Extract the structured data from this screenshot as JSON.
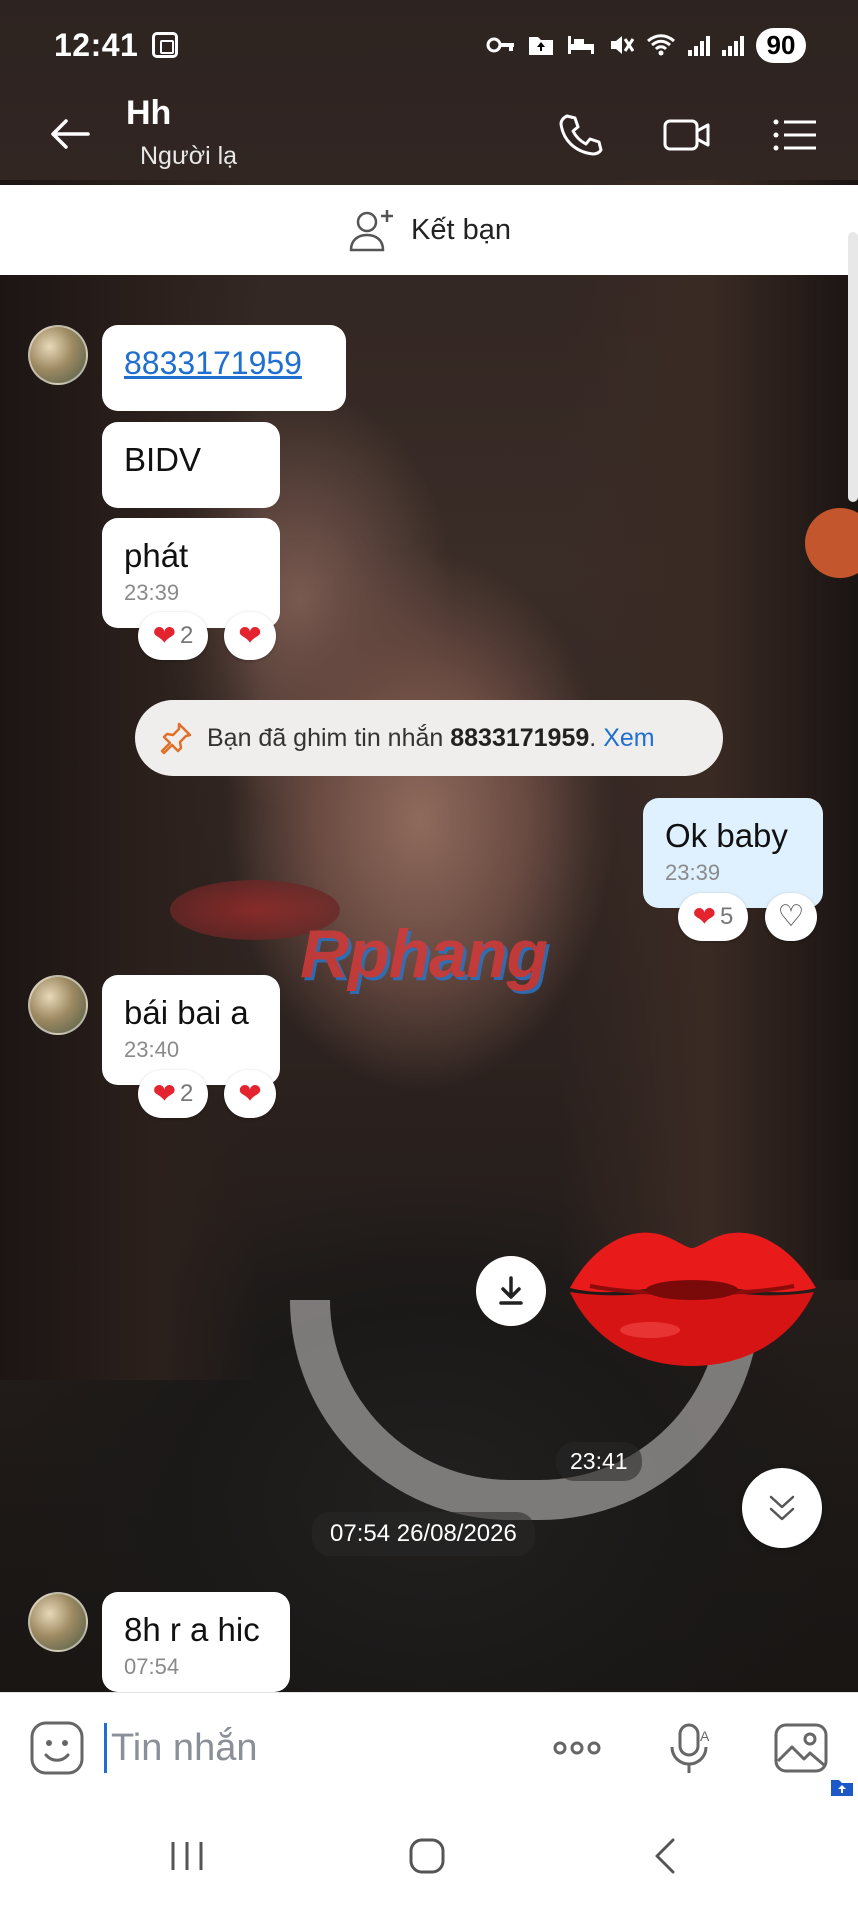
{
  "status_bar": {
    "time": "12:41",
    "battery": "90"
  },
  "header": {
    "contact_name": "Hh",
    "contact_status": "Người lạ"
  },
  "friend_bar": {
    "label": "Kết bạn"
  },
  "messages": [
    {
      "from": "them",
      "text": "8833171959",
      "is_link": true
    },
    {
      "from": "them",
      "text": "BIDV"
    },
    {
      "from": "them",
      "text": "phát",
      "time": "23:39",
      "reactions": [
        {
          "emoji": "heart",
          "count": "2"
        },
        {
          "emoji": "heart",
          "count": ""
        }
      ]
    },
    {
      "from": "me",
      "text": "Ok baby",
      "time": "23:39",
      "reactions": [
        {
          "emoji": "heart",
          "count": "5"
        },
        {
          "emoji": "heart-outline",
          "count": ""
        }
      ]
    },
    {
      "from": "them",
      "text": "bái bai a",
      "time": "23:40",
      "reactions": [
        {
          "emoji": "heart",
          "count": "2"
        },
        {
          "emoji": "heart",
          "count": ""
        }
      ]
    },
    {
      "from": "them",
      "type": "sticker",
      "sticker": "red-lips",
      "time": "23:41"
    },
    {
      "from": "them",
      "text": "8h r a hic",
      "time": "07:54"
    }
  ],
  "pin_notice": {
    "prefix": "Bạn đã ghim tin nhắn ",
    "value": "8833171959",
    "suffix": ".",
    "action": "Xem"
  },
  "date_separator": "07:54 26/08/2026",
  "watermark": "Rphang",
  "composer": {
    "placeholder": "Tin nhắn"
  },
  "colors": {
    "link": "#1f6fd0",
    "heart": "#e3232e",
    "my_bubble": "#dff1fe"
  }
}
